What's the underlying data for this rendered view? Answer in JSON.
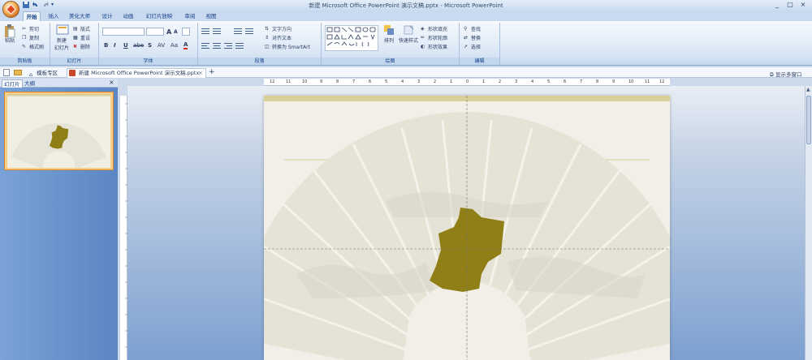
{
  "window": {
    "title": "新建 Microsoft Office PowerPoint 演示文稿.pptx - Microsoft PowerPoint",
    "controls": [
      "_",
      "□",
      "×"
    ]
  },
  "ribbon_tabs": [
    "开始",
    "插入",
    "美化大师",
    "设计",
    "动画",
    "幻灯片放映",
    "审阅",
    "视图"
  ],
  "clipboard": {
    "paste": "粘贴",
    "cut": "剪切",
    "copy": "复制",
    "format_painter": "格式刷",
    "label": "剪贴板"
  },
  "slides_group": {
    "new_slide_line1": "新建",
    "new_slide_line2": "幻灯片",
    "layout": "版式",
    "reset": "重设",
    "delete": "删除",
    "label": "幻灯片"
  },
  "font_group": {
    "bold": "B",
    "italic": "I",
    "underline": "U",
    "strike": "abe",
    "shadow": "S",
    "spacing": "AV",
    "case": "Aa",
    "color": "A",
    "grow": "A",
    "shrink": "A",
    "label": "字体"
  },
  "paragraph_group": {
    "text_direction": "文字方向",
    "align_text": "对齐文本",
    "smartart": "转换为 SmartArt",
    "label": "段落"
  },
  "drawing_group": {
    "arrange": "排列",
    "quick_styles": "快速样式",
    "shape_fill": "形状填充",
    "shape_outline": "形状轮廓",
    "shape_effects": "形状效果",
    "label": "绘图"
  },
  "editing_group": {
    "find": "查找",
    "replace": "替换",
    "select": "选择",
    "label": "编辑"
  },
  "doc_tabs": {
    "template_tab": "模板专区",
    "doc_tab": "新建 Microsoft Office PowerPoint 演示文稿.pptx",
    "add": "+",
    "multi_window": "显示多窗口"
  },
  "pane_tabs": {
    "slides": "幻灯片",
    "outline": "大纲",
    "close": "×"
  },
  "slide_number": "1",
  "ruler_ticks": [
    "12",
    "11",
    "10",
    "9",
    "8",
    "7",
    "6",
    "5",
    "4",
    "3",
    "2",
    "1",
    "0",
    "1",
    "2",
    "3",
    "4",
    "5",
    "6",
    "7",
    "8",
    "9",
    "10",
    "11",
    "12"
  ],
  "colors": {
    "accent": "#8f7f16",
    "ribbon": "#dbe7f5",
    "slide_bg": "#f1efe7",
    "gold_band": "#d9cf9a"
  }
}
